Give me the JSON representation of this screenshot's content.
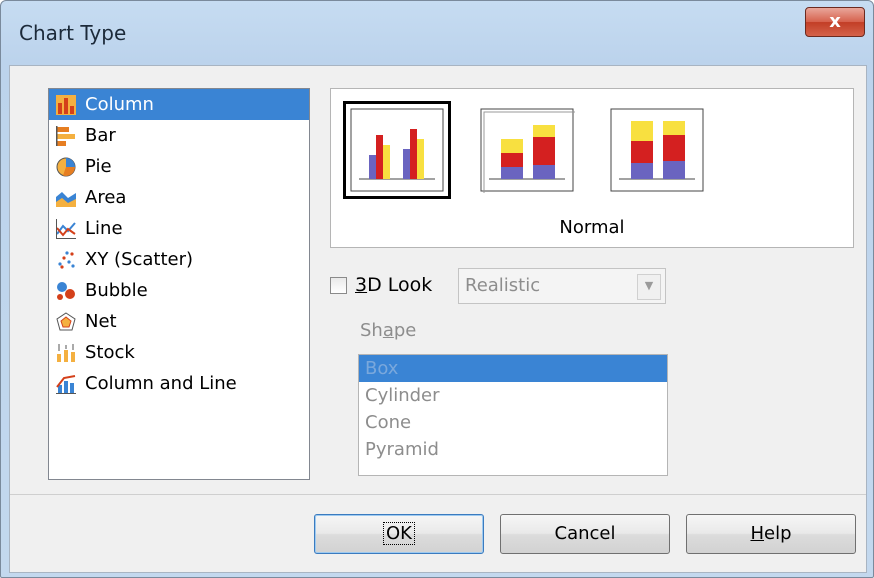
{
  "window": {
    "title": "Chart Type",
    "close_glyph": "x"
  },
  "chart_types": [
    {
      "label": "Column",
      "icon": "column-chart-icon",
      "selected": true
    },
    {
      "label": "Bar",
      "icon": "bar-chart-icon"
    },
    {
      "label": "Pie",
      "icon": "pie-chart-icon"
    },
    {
      "label": "Area",
      "icon": "area-chart-icon"
    },
    {
      "label": "Line",
      "icon": "line-chart-icon"
    },
    {
      "label": "XY (Scatter)",
      "icon": "scatter-chart-icon"
    },
    {
      "label": "Bubble",
      "icon": "bubble-chart-icon"
    },
    {
      "label": "Net",
      "icon": "net-chart-icon"
    },
    {
      "label": "Stock",
      "icon": "stock-chart-icon"
    },
    {
      "label": "Column and Line",
      "icon": "column-line-chart-icon"
    }
  ],
  "variant": {
    "label": "Normal"
  },
  "look3d": {
    "label_prefix": "",
    "label_mnemonic": "3",
    "label_suffix": "D Look",
    "checked": false
  },
  "look_combo": {
    "value": "Realistic",
    "arrow": "▼"
  },
  "shape": {
    "label_prefix": "Sh",
    "label_mnemonic": "a",
    "label_suffix": "pe",
    "items": [
      "Box",
      "Cylinder",
      "Cone",
      "Pyramid"
    ]
  },
  "buttons": {
    "ok": "OK",
    "cancel": "Cancel",
    "help_mnemonic": "H",
    "help_suffix": "elp"
  },
  "colors": {
    "selection": "#3a84d4",
    "bar_purple": "#6a64c0",
    "bar_red": "#d42020",
    "bar_yellow": "#f8e040"
  }
}
